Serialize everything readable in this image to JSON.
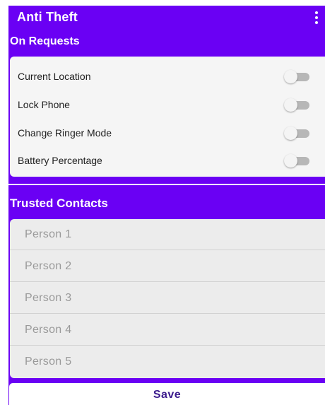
{
  "appbar": {
    "title": "Anti Theft",
    "menu_icon": "overflow-menu-icon"
  },
  "on_requests": {
    "title": "On Requests",
    "items": [
      {
        "label": "Current Location",
        "enabled": false
      },
      {
        "label": "Lock Phone",
        "enabled": false
      },
      {
        "label": "Change Ringer Mode",
        "enabled": false
      },
      {
        "label": "Battery Percentage",
        "enabled": false
      }
    ]
  },
  "trusted_contacts": {
    "title": "Trusted Contacts",
    "fields": [
      {
        "placeholder": "Person 1",
        "value": ""
      },
      {
        "placeholder": "Person 2",
        "value": ""
      },
      {
        "placeholder": "Person 3",
        "value": ""
      },
      {
        "placeholder": "Person 4",
        "value": ""
      },
      {
        "placeholder": "Person 5",
        "value": ""
      }
    ]
  },
  "save_button": {
    "label": "Save"
  },
  "colors": {
    "primary": "#6a00f4",
    "card_background": "#f5f5f5",
    "field_background": "#ececec",
    "save_text": "#3a1a8c"
  }
}
